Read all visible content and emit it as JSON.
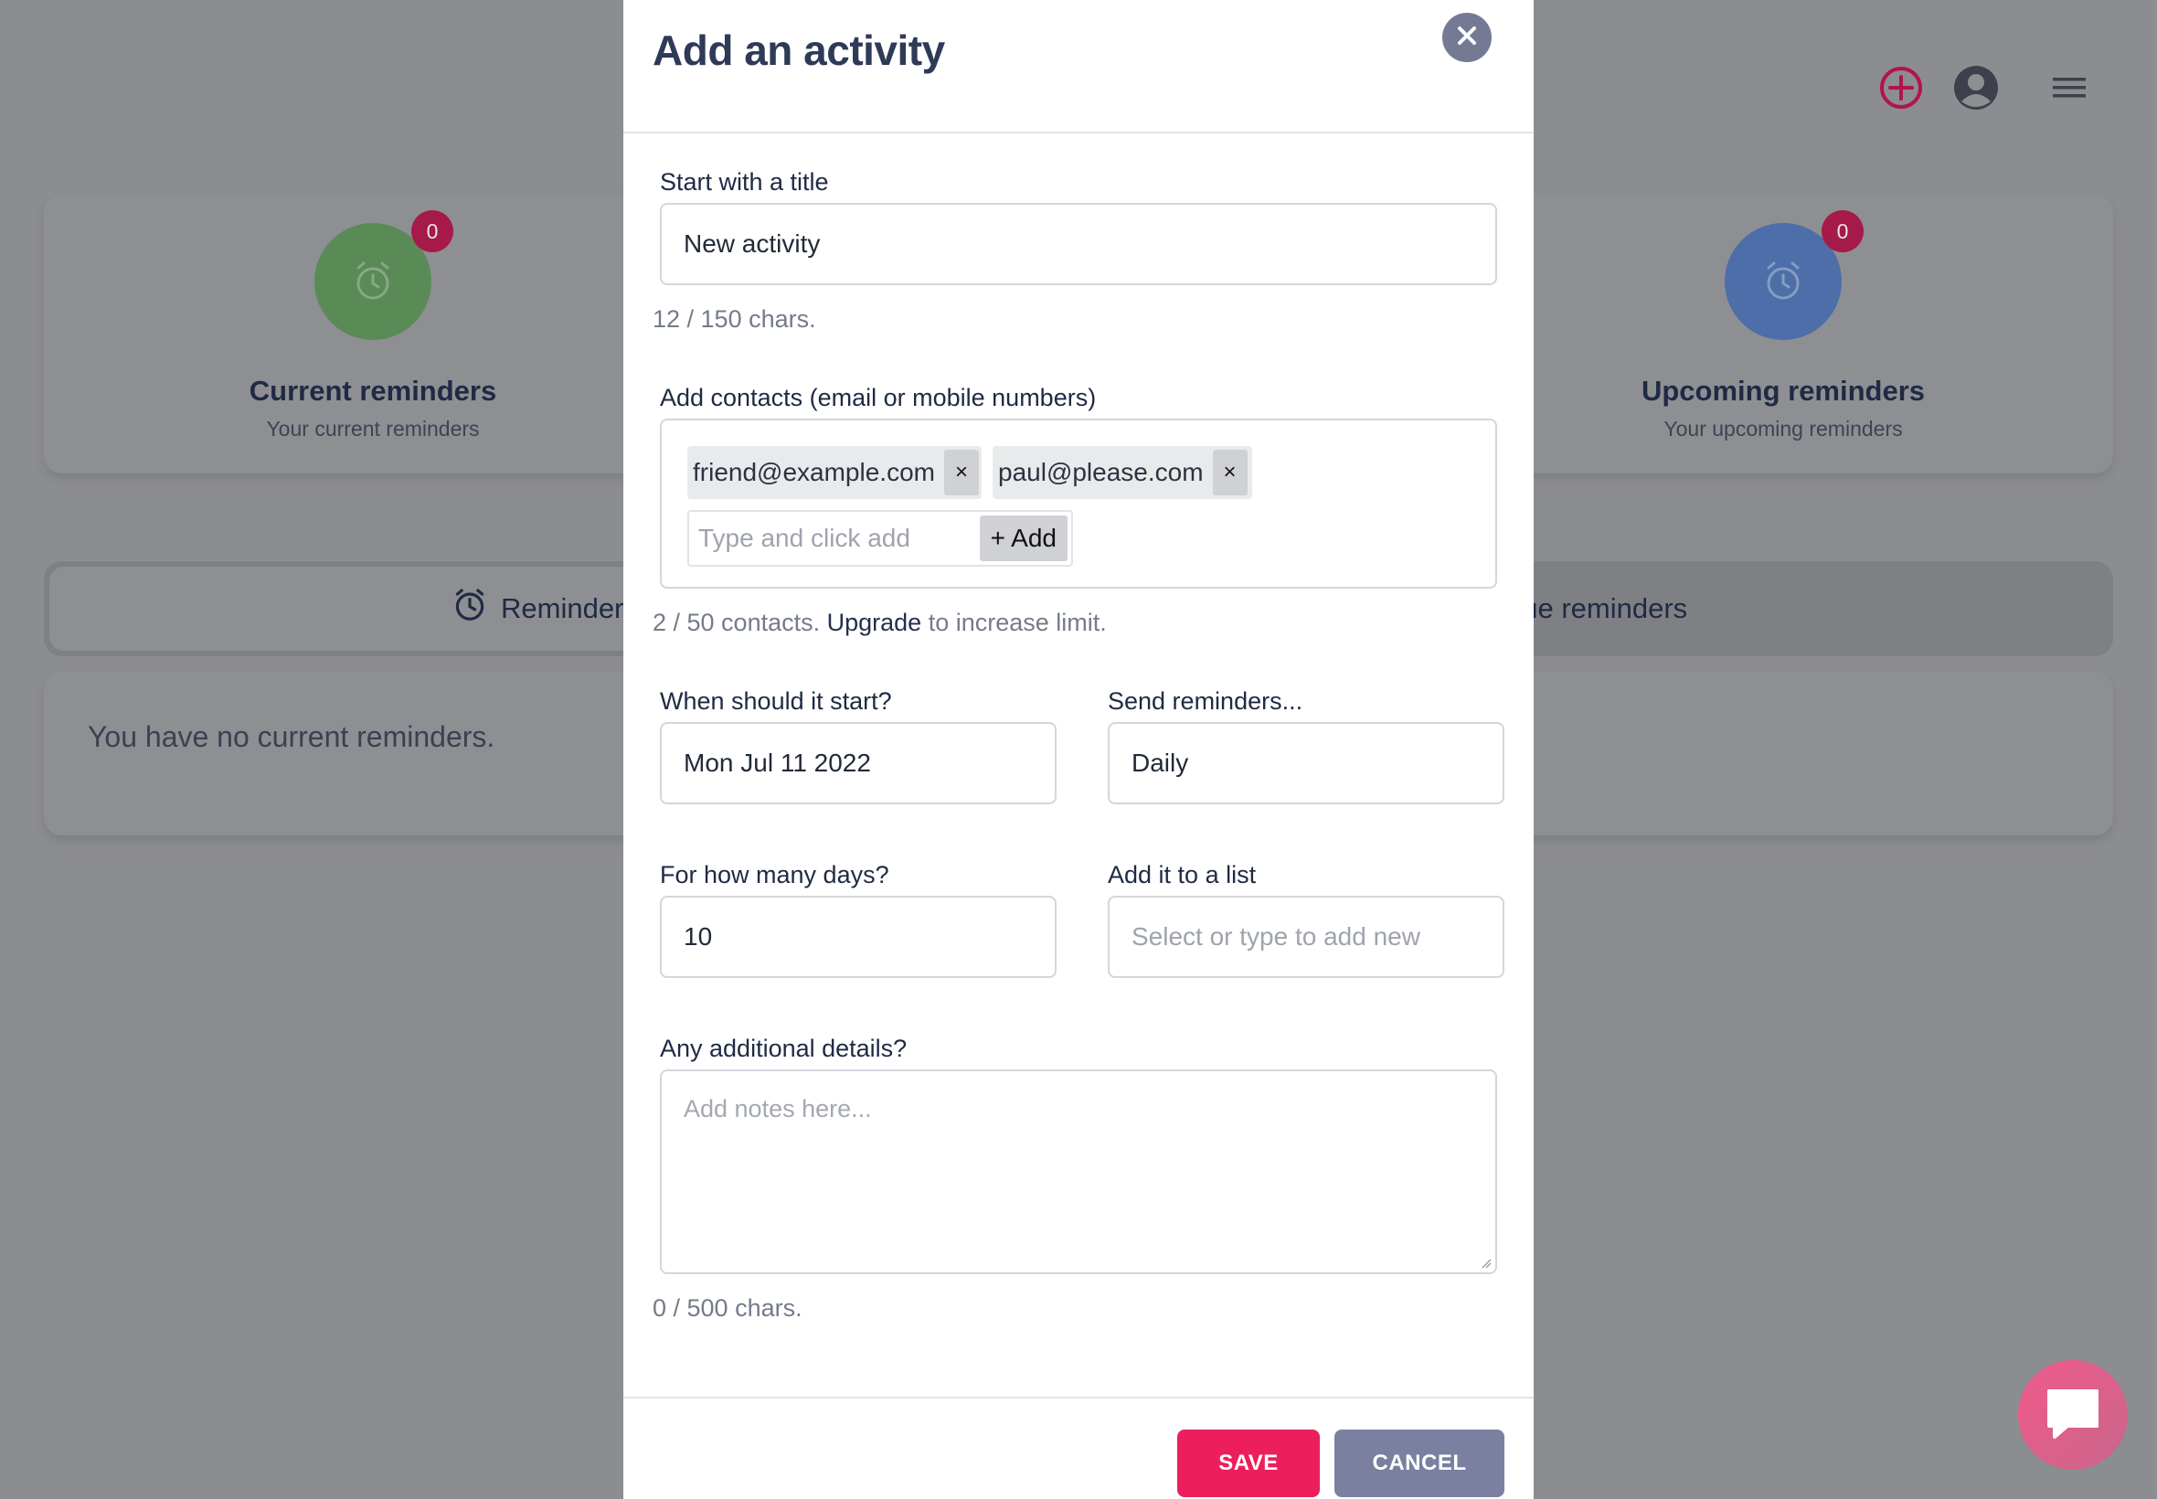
{
  "header": {
    "add_icon": "plus-circle-icon",
    "profile_icon": "user-circle-icon",
    "menu_icon": "hamburger-menu-icon",
    "add_icon_color": "#b0154c"
  },
  "stats": {
    "current": {
      "badge": "0",
      "title": "Current reminders",
      "subtitle": "Your current reminders",
      "color": "#5a8b56"
    },
    "upcoming": {
      "badge": "0",
      "title": "Upcoming reminders",
      "subtitle": "Your upcoming reminders",
      "color": "#4d6ea8"
    }
  },
  "tabs": {
    "reminders": "Reminders",
    "overdue": "due reminders"
  },
  "empty_message": "You have no current reminders.",
  "modal": {
    "title": "Add an activity",
    "title_field": {
      "label": "Start with a title",
      "value": "New activity",
      "counter": "12 / 150 chars."
    },
    "contacts": {
      "label": "Add contacts (email or mobile numbers)",
      "chips": [
        "friend@example.com",
        "paul@please.com"
      ],
      "remove_glyph": "×",
      "input_placeholder": "Type and click add",
      "add_label": "+ Add",
      "count_text": "2 / 50 contacts.",
      "upgrade_link": "Upgrade",
      "upgrade_suffix": "to increase limit."
    },
    "start": {
      "label": "When should it start?",
      "value": "Mon Jul 11 2022"
    },
    "frequency": {
      "label": "Send reminders...",
      "value": "Daily"
    },
    "days": {
      "label": "For how many days?",
      "value": "10"
    },
    "list": {
      "label": "Add it to a list",
      "placeholder": "Select or type to add new"
    },
    "details": {
      "label": "Any additional details?",
      "placeholder": "Add notes here...",
      "counter": "0 / 500 chars."
    },
    "save_label": "SAVE",
    "cancel_label": "CANCEL",
    "save_color": "#ec1f5c",
    "cancel_color": "#7b80a0"
  },
  "chat": {
    "icon": "chat-bubble-icon"
  }
}
